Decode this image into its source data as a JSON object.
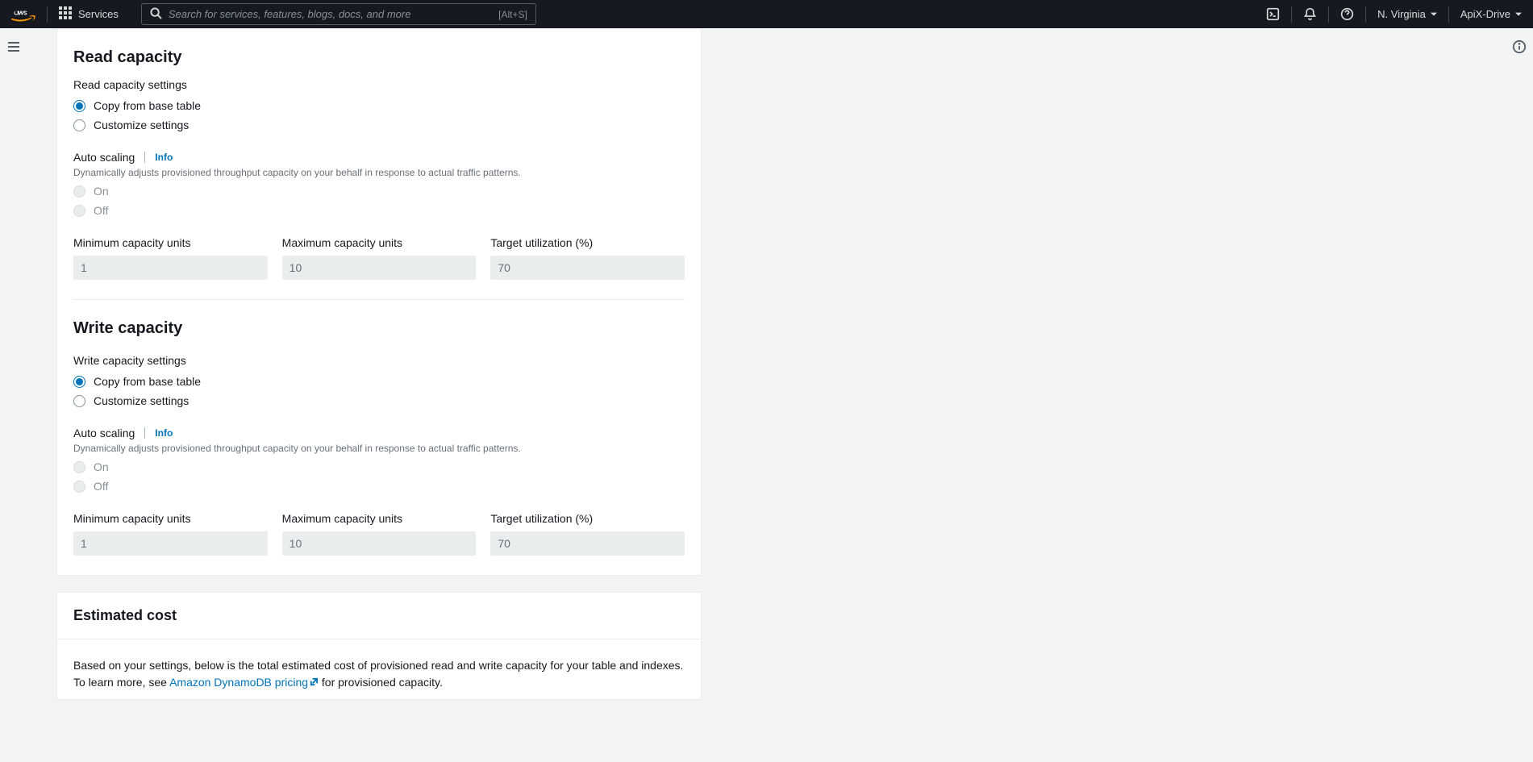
{
  "topnav": {
    "services_label": "Services",
    "search_placeholder": "Search for services, features, blogs, docs, and more",
    "search_shortcut": "[Alt+S]",
    "region": "N. Virginia",
    "account": "ApiX-Drive"
  },
  "read_capacity": {
    "heading": "Read capacity",
    "settings_label": "Read capacity settings",
    "option_copy": "Copy from base table",
    "option_custom": "Customize settings",
    "auto_scaling_label": "Auto scaling",
    "info_label": "Info",
    "auto_scaling_desc": "Dynamically adjusts provisioned throughput capacity on your behalf in response to actual traffic patterns.",
    "option_on": "On",
    "option_off": "Off",
    "min_label": "Minimum capacity units",
    "min_value": "1",
    "max_label": "Maximum capacity units",
    "max_value": "10",
    "target_label": "Target utilization (%)",
    "target_value": "70"
  },
  "write_capacity": {
    "heading": "Write capacity",
    "settings_label": "Write capacity settings",
    "option_copy": "Copy from base table",
    "option_custom": "Customize settings",
    "auto_scaling_label": "Auto scaling",
    "info_label": "Info",
    "auto_scaling_desc": "Dynamically adjusts provisioned throughput capacity on your behalf in response to actual traffic patterns.",
    "option_on": "On",
    "option_off": "Off",
    "min_label": "Minimum capacity units",
    "min_value": "1",
    "max_label": "Maximum capacity units",
    "max_value": "10",
    "target_label": "Target utilization (%)",
    "target_value": "70"
  },
  "estimated_cost": {
    "heading": "Estimated cost",
    "text_1": "Based on your settings, below is the total estimated cost of provisioned read and write capacity for your table and indexes. To learn more, see ",
    "link_label": "Amazon DynamoDB pricing",
    "text_2": " for provisioned capacity."
  }
}
